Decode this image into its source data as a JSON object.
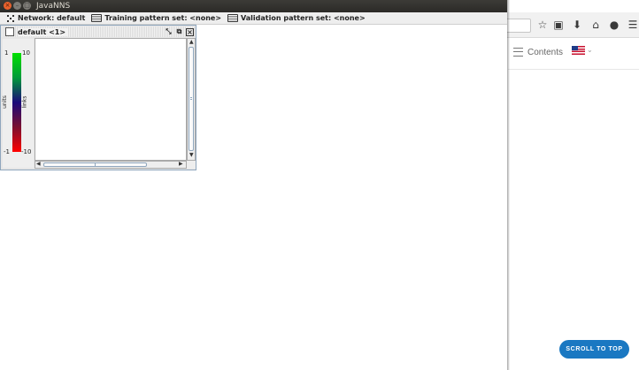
{
  "window": {
    "title": "JavaNNS"
  },
  "status": {
    "network": "Network: default",
    "training": "Training pattern set: <none>",
    "validation": "Validation pattern set: <none>"
  },
  "frame": {
    "title": "default <1>",
    "legend": {
      "left_top": "1",
      "left_bottom": "-1",
      "right_top": "10",
      "right_bottom": "-10",
      "left_axis_label": "units",
      "right_axis_label": "links"
    }
  },
  "browser": {
    "contents_label": "Contents",
    "scroll_top_label": "SCROLL TO TOP",
    "toolbar_icons": [
      "star-icon",
      "clipboard-icon",
      "download-icon",
      "home-icon",
      "chat-icon",
      "menu-icon"
    ]
  },
  "colors": {
    "scroll_button": "#1a78c2",
    "titlebar": "#3c3b37",
    "close_button": "#e8612c"
  }
}
